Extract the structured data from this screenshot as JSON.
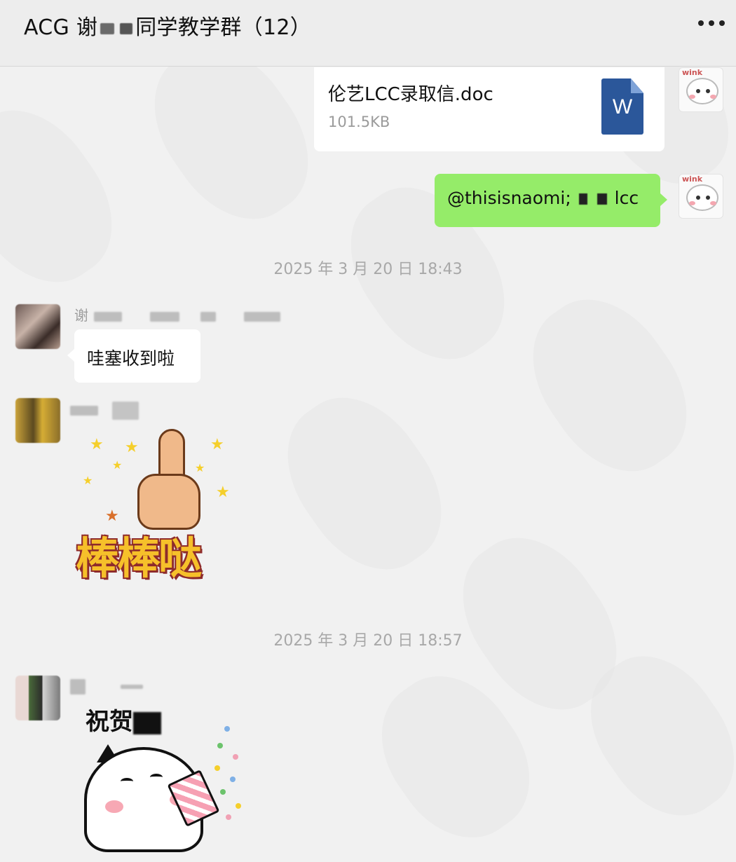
{
  "header": {
    "title_left": "ACG 谢",
    "title_right": "同学教学群（12）"
  },
  "messages": {
    "file": {
      "name": "伦艺LCC录取信.doc",
      "size": "101.5KB",
      "icon_letter": "W"
    },
    "mention": {
      "text_left": "@thisisnaomi;",
      "text_right": "lcc"
    },
    "time1": "2025 年 3 月 20 日 18:43",
    "sender1": "谢",
    "reply": "哇塞收到啦",
    "sticker1_text": "棒棒哒",
    "time2": "2025 年 3 月 20 日 18:57",
    "sticker2_text": "祝贺"
  },
  "colors": {
    "background": "#f1f1f1",
    "header_bg": "#ededed",
    "bubble_green": "#95ec69",
    "bubble_white": "#ffffff",
    "doc_icon": "#2b579a"
  },
  "icons": {
    "more": "more-dots-icon",
    "doc": "word-doc-icon"
  }
}
